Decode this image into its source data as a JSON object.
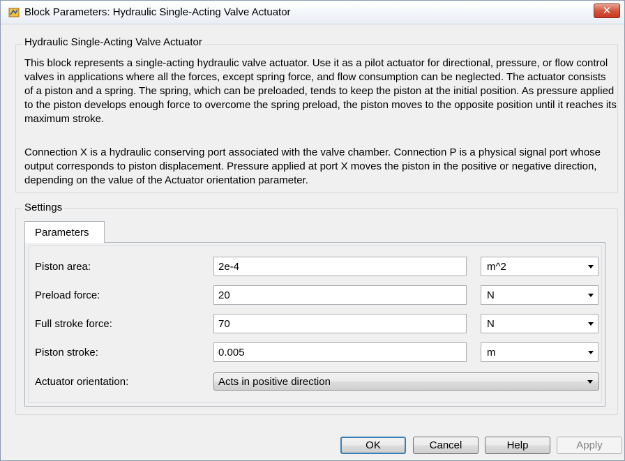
{
  "window": {
    "title": "Block Parameters: Hydraulic Single-Acting Valve Actuator",
    "close_label": "✕"
  },
  "description": {
    "group_label": "Hydraulic Single-Acting Valve Actuator",
    "paragraph1": "This block represents a single-acting hydraulic valve actuator. Use it as a pilot actuator for directional, pressure, or flow control valves in applications where all the forces, except spring force, and flow consumption can be neglected. The actuator consists of a piston and a spring. The spring, which can be preloaded, tends to keep the piston at the initial position. As pressure applied to the piston develops enough force to overcome the spring preload, the piston moves to the opposite position until it reaches its maximum stroke.",
    "paragraph2": "Connection X is a hydraulic conserving port associated with the valve chamber. Connection P is a physical signal port whose output corresponds to piston displacement. Pressure applied at port X moves the piston in the positive or negative direction, depending on the value of the Actuator orientation parameter."
  },
  "settings": {
    "group_label": "Settings",
    "tab_label": "Parameters",
    "params": [
      {
        "label": "Piston area:",
        "value": "2e-4",
        "unit": "m^2"
      },
      {
        "label": "Preload force:",
        "value": "20",
        "unit": "N"
      },
      {
        "label": "Full stroke force:",
        "value": "70",
        "unit": "N"
      },
      {
        "label": "Piston stroke:",
        "value": "0.005",
        "unit": "m"
      }
    ],
    "orientation": {
      "label": "Actuator orientation:",
      "value": "Acts in positive direction"
    }
  },
  "buttons": {
    "ok": "OK",
    "cancel": "Cancel",
    "help": "Help",
    "apply": "Apply"
  },
  "icons": {
    "app": "simulink-block-icon",
    "close": "close-icon",
    "dropdown": "chevron-down-icon"
  },
  "colors": {
    "close_button": "#c7381f",
    "default_button_border": "#3c7fb1",
    "background": "#f0f0f0"
  }
}
